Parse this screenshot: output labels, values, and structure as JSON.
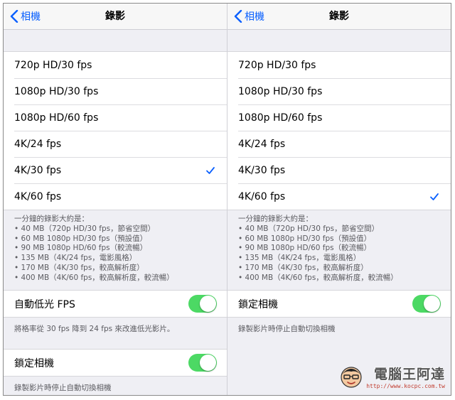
{
  "left": {
    "nav": {
      "back_label": "相機",
      "title": "錄影"
    },
    "options": [
      {
        "label": "720p HD/30 fps",
        "selected": false
      },
      {
        "label": "1080p HD/30 fps",
        "selected": false
      },
      {
        "label": "1080p HD/60 fps",
        "selected": false
      },
      {
        "label": "4K/24 fps",
        "selected": false
      },
      {
        "label": "4K/30 fps",
        "selected": true
      },
      {
        "label": "4K/60 fps",
        "selected": false
      }
    ],
    "size_info": [
      "一分鐘的錄影大約是：",
      "• 40 MB（720p HD/30 fps，節省空間）",
      "• 60 MB 1080p HD/30 fps（預設值）",
      "• 90 MB 1080p HD/60 fps（較流暢）",
      "• 135 MB（4K/24 fps，電影風格）",
      "• 170 MB（4K/30 fps，較高解析度）",
      "• 400 MB（4K/60 fps，較高解析度，較流暢）"
    ],
    "low_light": {
      "label": "自動低光 FPS",
      "on": true,
      "note": "將格率從 30 fps 降到 24 fps 來改進低光影片。"
    },
    "lock_camera": {
      "label": "鎖定相機",
      "on": true,
      "note": "錄製影片時停止自動切換相機"
    }
  },
  "right": {
    "nav": {
      "back_label": "相機",
      "title": "錄影"
    },
    "options": [
      {
        "label": "720p HD/30 fps",
        "selected": false
      },
      {
        "label": "1080p HD/30 fps",
        "selected": false
      },
      {
        "label": "1080p HD/60 fps",
        "selected": false
      },
      {
        "label": "4K/24 fps",
        "selected": false
      },
      {
        "label": "4K/30 fps",
        "selected": false
      },
      {
        "label": "4K/60 fps",
        "selected": true
      }
    ],
    "size_info": [
      "一分鐘的錄影大約是：",
      "• 40 MB（720p HD/30 fps，節省空間）",
      "• 60 MB 1080p HD/30 fps（預設值）",
      "• 90 MB 1080p HD/60 fps（較流暢）",
      "• 135 MB（4K/24 fps，電影風格）",
      "• 170 MB（4K/30 fps，較高解析度）",
      "• 400 MB（4K/60 fps，較高解析度，較流暢）"
    ],
    "lock_camera": {
      "label": "鎖定相機",
      "on": true,
      "note": "錄製影片時停止自動切換相機"
    }
  },
  "watermark": {
    "title": "電腦王阿達",
    "url": "http://www.kocpc.com.tw"
  },
  "colors": {
    "accent": "#0a60fe",
    "switch_on": "#4cd964",
    "group_bg": "#efeff4",
    "footer_text": "#5b5b60"
  },
  "icons": {
    "back": "chevron-left-icon",
    "check": "checkmark-icon"
  }
}
